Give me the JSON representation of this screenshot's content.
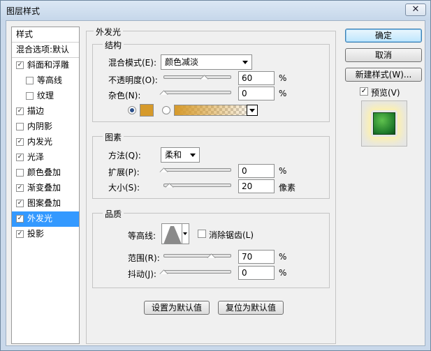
{
  "window": {
    "title": "图层样式",
    "close": "✕"
  },
  "styles_list": {
    "header": "样式",
    "blend_options": "混合选项:默认",
    "items": [
      {
        "label": "斜面和浮雕",
        "checked": true
      },
      {
        "label": "等高线",
        "checked": false,
        "indent": true
      },
      {
        "label": "纹理",
        "checked": false,
        "indent": true
      },
      {
        "label": "描边",
        "checked": true
      },
      {
        "label": "内阴影",
        "checked": false
      },
      {
        "label": "内发光",
        "checked": true
      },
      {
        "label": "光泽",
        "checked": true
      },
      {
        "label": "颜色叠加",
        "checked": false
      },
      {
        "label": "渐变叠加",
        "checked": true
      },
      {
        "label": "图案叠加",
        "checked": true
      },
      {
        "label": "外发光",
        "checked": true,
        "selected": true
      },
      {
        "label": "投影",
        "checked": true
      }
    ]
  },
  "panel": {
    "title": "外发光",
    "structure": {
      "title": "结构",
      "blend_mode_label": "混合模式(E):",
      "blend_mode_value": "颜色减淡",
      "opacity_label": "不透明度(O):",
      "opacity_value": "60",
      "opacity_unit": "%",
      "noise_label": "杂色(N):",
      "noise_value": "0",
      "noise_unit": "%",
      "glow_color": "#d69a2b"
    },
    "elements": {
      "title": "图素",
      "technique_label": "方法(Q):",
      "technique_value": "柔和",
      "spread_label": "扩展(P):",
      "spread_value": "0",
      "spread_unit": "%",
      "size_label": "大小(S):",
      "size_value": "20",
      "size_unit": "像素"
    },
    "quality": {
      "title": "品质",
      "contour_label": "等高线:",
      "antialias_label": "消除锯齿(L)",
      "range_label": "范围(R):",
      "range_value": "70",
      "range_unit": "%",
      "jitter_label": "抖动(J):",
      "jitter_value": "0",
      "jitter_unit": "%"
    },
    "make_default": "设置为默认值",
    "reset_default": "复位为默认值"
  },
  "buttons": {
    "ok": "确定",
    "cancel": "取消",
    "new_style": "新建样式(W)...",
    "preview": "预览(V)"
  },
  "colors": {
    "selection": "#3399ff",
    "accent": "#3c7fb1"
  },
  "levels": {
    "opacity": 0.6,
    "noise": 0.0,
    "spread": 0.0,
    "size": 0.08,
    "range": 0.7,
    "jitter": 0.0
  }
}
